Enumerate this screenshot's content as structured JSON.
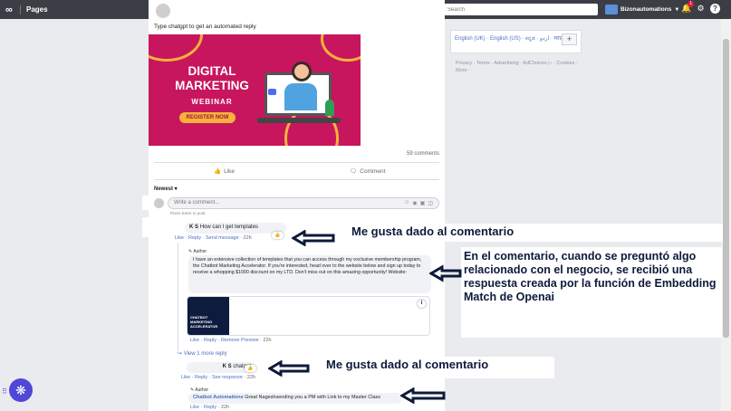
{
  "topbar": {
    "logo": "∞",
    "title": "Pages",
    "search_placeholder": "Search",
    "account_name": "Bizonautomations",
    "notif_count": "1",
    "icons": [
      "meta-logo-icon",
      "search-icon",
      "bell-icon",
      "gear-icon",
      "help-icon"
    ]
  },
  "post": {
    "text": "Type chatgpt to get an automated reply",
    "banner": {
      "title": "DIGITAL MARKETING",
      "subtitle": "WEBINAR",
      "button": "REGISTER NOW"
    },
    "comments_count": "59 comments",
    "like_label": "Like",
    "comment_label": "Comment",
    "sort_label": "Newest",
    "write_placeholder": "Write a comment...",
    "press_enter": "Press Enter to post."
  },
  "comments": [
    {
      "name": "K S",
      "text": "How can I get templates",
      "actions": [
        "Like",
        "Reply",
        "Send message"
      ],
      "time": "22h"
    },
    {
      "author_tag": "Author",
      "text": "I have an extensive collection of templates that you can access through my exclusive membership program, the Chatbot Marketing Accelerator. If you're interested, head over to the website below and sign up today to receive a whopping $1000 discount on my LTD. Don't miss out on this amazing opportunity! Website:",
      "preview_label": "CHATBOT MARKETING ACCELERATOR",
      "actions": [
        "Like",
        "Reply",
        "Remove Preview"
      ],
      "time": "22h"
    },
    {
      "view_more": "View 1 more reply"
    },
    {
      "name": "K S",
      "text": "chatgpt",
      "actions": [
        "Like",
        "Reply",
        "See response"
      ],
      "time": "22h"
    },
    {
      "author_tag": "Author",
      "name": "Chatbot Automations",
      "text": "Great Nageshsending you a PM with Link to my Master Class",
      "actions": [
        "Like",
        "Reply"
      ],
      "time": "22h"
    }
  ],
  "right_column": {
    "languages": "English (UK) · English (US) · ಕನ್ನಡ · اردو · मराठी",
    "plus": "+",
    "footer": "Privacy · Terms · Advertising · AdChoices ▷ · Cookies · More ·"
  },
  "annotations": {
    "note1": "Me gusta dado al comentario",
    "note2": "En el comentario, cuando se preguntó algo relacionado con el negocio, se recibió una respuesta creada por la función de Embedding Match de Openai",
    "note3": "Me gusta dado al comentario"
  },
  "colors": {
    "topbar": "#3b3f45",
    "banner": "#c8165e",
    "accent_link": "#4b6fc1",
    "arrow": "#0d1a3a",
    "fab": "#4f47d6"
  }
}
